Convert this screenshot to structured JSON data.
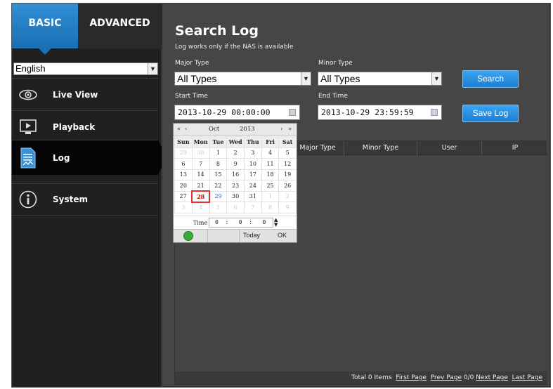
{
  "tabs": {
    "basic": "BASIC",
    "advanced": "ADVANCED"
  },
  "language": {
    "value": "English"
  },
  "sidebar": {
    "items": [
      {
        "label": "Live View",
        "icon": "eye-icon"
      },
      {
        "label": "Playback",
        "icon": "play-icon"
      },
      {
        "label": "Log",
        "icon": "document-icon"
      },
      {
        "label": "System",
        "icon": "info-icon"
      }
    ]
  },
  "page": {
    "title": "Search Log",
    "subtitle": "Log works only if the NAS is available"
  },
  "filters": {
    "major_type_label": "Major Type",
    "major_type_value": "All Types",
    "minor_type_label": "Minor Type",
    "minor_type_value": "All Types",
    "start_time_label": "Start Time",
    "start_time_value": "2013-10-29 00:00:00",
    "end_time_label": "End Time",
    "end_time_value": "2013-10-29 23:59:59"
  },
  "buttons": {
    "search": "Search",
    "save_log": "Save Log"
  },
  "table": {
    "columns": [
      "Major Type",
      "Minor Type",
      "User",
      "IP"
    ],
    "footer": {
      "total": "Total 0 Items",
      "first": "First Page",
      "prev": "Prev Page",
      "pages": "0/0",
      "next": "Next Page",
      "last": "Last Page"
    }
  },
  "calendar": {
    "nav_prev_year": "«",
    "nav_prev_month": "‹",
    "month": "Oct",
    "year": "2013",
    "nav_next_month": "›",
    "nav_next_year": "»",
    "weekdays": [
      "Sun",
      "Mon",
      "Tue",
      "Wed",
      "Thu",
      "Fri",
      "Sat"
    ],
    "weeks": [
      [
        "29",
        "30",
        "1",
        "2",
        "3",
        "4",
        "5"
      ],
      [
        "6",
        "7",
        "8",
        "9",
        "10",
        "11",
        "12"
      ],
      [
        "13",
        "14",
        "15",
        "16",
        "17",
        "18",
        "19"
      ],
      [
        "20",
        "21",
        "22",
        "23",
        "24",
        "25",
        "26"
      ],
      [
        "27",
        "28",
        "29",
        "30",
        "31",
        "1",
        "2"
      ],
      [
        "3",
        "4",
        "5",
        "6",
        "7",
        "8",
        "9"
      ]
    ],
    "selected_day": "28",
    "today_day": "29",
    "time_label": "Time",
    "time_h": "0",
    "time_m": "0",
    "time_s": "0",
    "today_label": "Today",
    "ok_label": "OK",
    "colors": {
      "selected": "#d33333",
      "today": "#1a6fd0"
    }
  },
  "colors": {
    "accent": "#1b7fd3",
    "sidebar_bg": "#202020",
    "content_bg": "#464646"
  }
}
